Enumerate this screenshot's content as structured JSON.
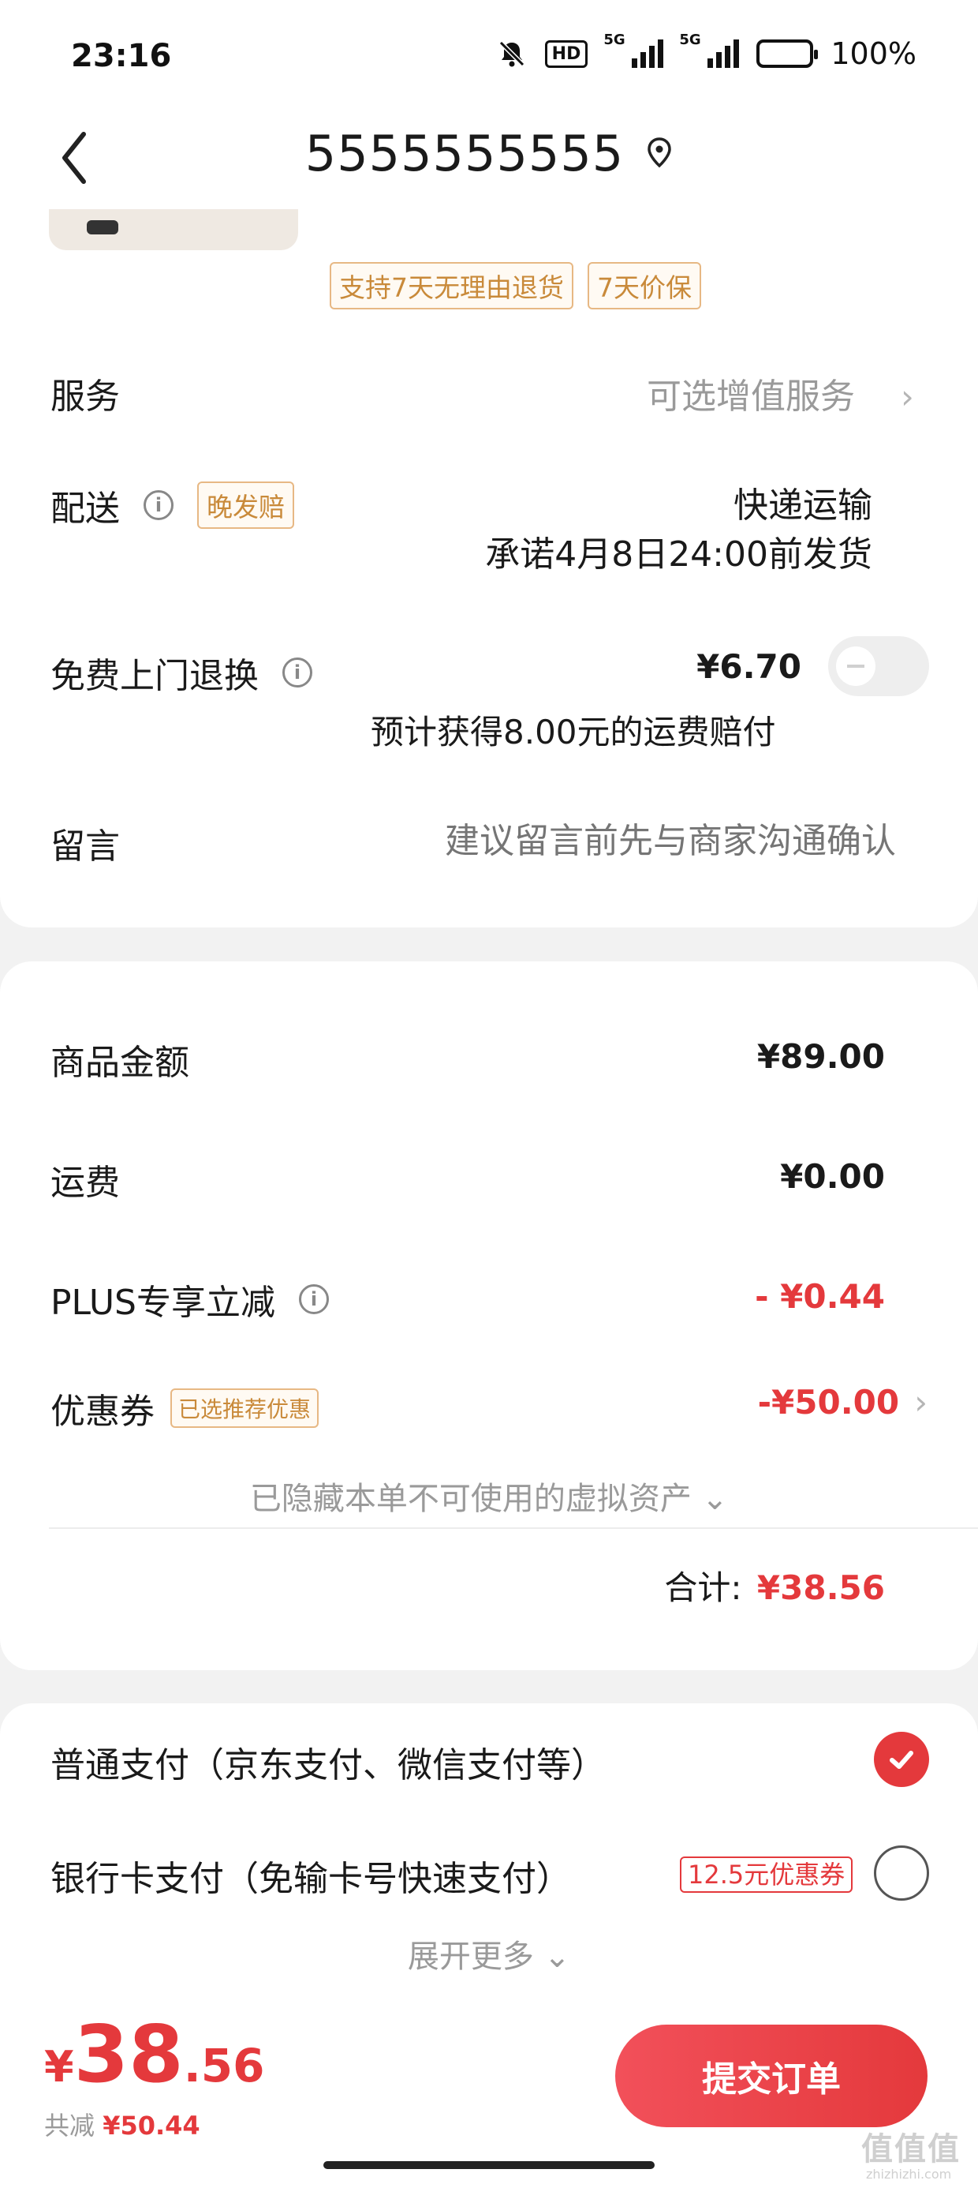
{
  "status_bar": {
    "time": "23:16",
    "hd_label": "HD",
    "net1": "5G",
    "net2": "5G",
    "battery": "100%",
    "icons": [
      "bell-off-icon",
      "hd-icon",
      "signal-icon",
      "signal-icon",
      "battery-icon"
    ]
  },
  "header": {
    "title": "5555555555",
    "icons": [
      "back-icon",
      "location-icon"
    ]
  },
  "product": {
    "tags": [
      "支持7天无理由退货",
      "7天价保"
    ]
  },
  "service": {
    "label": "服务",
    "value": "可选增值服务"
  },
  "delivery": {
    "label": "配送",
    "badge": "晚发赔",
    "method": "快递运输",
    "promise": "承诺4月8日24:00前发货"
  },
  "return_service": {
    "label": "免费上门退换",
    "price": "¥6.70",
    "note": "预计获得8.00元的运费赔付",
    "enabled": false
  },
  "message": {
    "label": "留言",
    "placeholder": "建议留言前先与商家沟通确认"
  },
  "summary": {
    "goods_label": "商品金额",
    "goods_value": "¥89.00",
    "shipping_label": "运费",
    "shipping_value": "¥0.00",
    "plus_label": "PLUS专享立减",
    "plus_value": "- ¥0.44",
    "coupon_label": "优惠券",
    "coupon_badge": "已选推荐优惠",
    "coupon_value": "-¥50.00",
    "hidden_assets": "已隐藏本单不可使用的虚拟资产",
    "total_label": "合计:",
    "total_value": "¥38.56"
  },
  "payment": {
    "option1": "普通支付（京东支付、微信支付等）",
    "option1_selected": true,
    "option2": "银行卡支付（免输卡号快速支付）",
    "option2_badge": "12.5元优惠券",
    "option2_selected": false,
    "expand": "展开更多"
  },
  "bottom": {
    "currency": "¥",
    "amount_int": "38",
    "amount_dec": ".56",
    "saved_label": "共减",
    "saved_value": "¥50.44",
    "submit": "提交订单"
  },
  "watermark": {
    "main": "值值值",
    "sub": "zhizhizhi.com"
  },
  "colors": {
    "accent": "#e4393c",
    "tag_border": "#e7b884",
    "tag_text": "#c98a3a",
    "background": "#f2f2f2"
  }
}
